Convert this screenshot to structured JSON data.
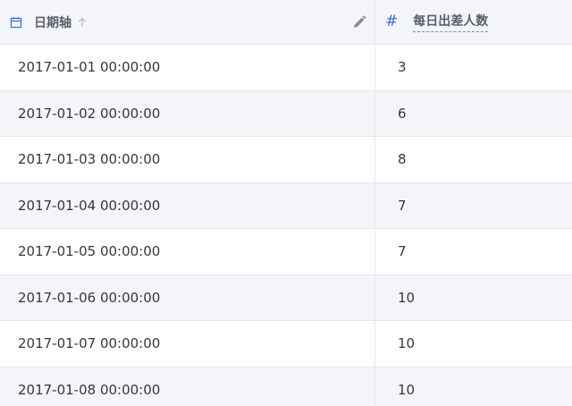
{
  "columns": {
    "date": {
      "label": "日期轴",
      "type_icon": "calendar-icon",
      "sort_icon": "arrow-up-icon",
      "edit_icon": "pencil-icon"
    },
    "count": {
      "label": "每日出差人数",
      "type_icon": "#"
    }
  },
  "rows": [
    {
      "date": "2017-01-01 00:00:00",
      "count": "3"
    },
    {
      "date": "2017-01-02 00:00:00",
      "count": "6"
    },
    {
      "date": "2017-01-03 00:00:00",
      "count": "8"
    },
    {
      "date": "2017-01-04 00:00:00",
      "count": "7"
    },
    {
      "date": "2017-01-05 00:00:00",
      "count": "7"
    },
    {
      "date": "2017-01-06 00:00:00",
      "count": "10"
    },
    {
      "date": "2017-01-07 00:00:00",
      "count": "10"
    },
    {
      "date": "2017-01-08 00:00:00",
      "count": "10"
    }
  ],
  "colors": {
    "accent": "#3b6fd8",
    "header_bg": "#f4f5f8",
    "alt_row_bg": "#f4f5f8",
    "border": "#e5e7eb"
  }
}
